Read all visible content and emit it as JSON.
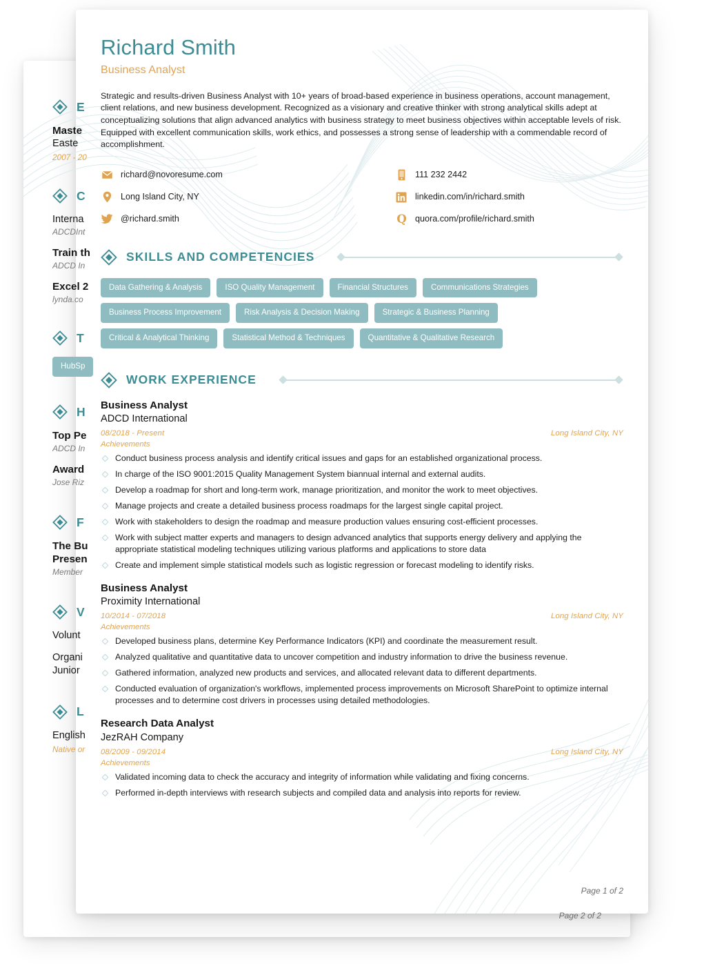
{
  "document": {
    "type": "resume",
    "theme": {
      "teal": "#3E8C93",
      "orange": "#E0A451",
      "chip": "#8FBCC0",
      "rule": "#CEDFE2",
      "text": "#1b1b1b"
    }
  },
  "page_front": {
    "footer": "Page 1 of 2",
    "header": {
      "name": "Richard Smith",
      "job_title": "Business Analyst",
      "summary": "Strategic and results-driven Business Analyst with 10+ years of broad-based experience in business operations, account management, client relations, and new business development. Recognized as a visionary and creative thinker with strong analytical skills adept at conceptualizing solutions that align advanced analytics with business strategy to meet business objectives within acceptable levels of risk. Equipped with excellent communication skills, work ethics, and possesses a strong sense of leadership with a commendable record of accomplishment."
    },
    "contacts": {
      "left": [
        {
          "icon": "email-icon",
          "value": "richard@novoresume.com"
        },
        {
          "icon": "location-icon",
          "value": "Long Island City, NY"
        },
        {
          "icon": "twitter-icon",
          "value": "@richard.smith"
        }
      ],
      "right": [
        {
          "icon": "phone-icon",
          "value": "111 232 2442"
        },
        {
          "icon": "linkedin-icon",
          "value": "linkedin.com/in/richard.smith"
        },
        {
          "icon": "quora-icon",
          "value": "quora.com/profile/richard.smith"
        }
      ]
    },
    "skills_section": {
      "title": "SKILLS AND COMPETENCIES",
      "chips": [
        "Data Gathering & Analysis",
        "ISO Quality Management",
        "Financial Structures",
        "Communications Strategies",
        "Business Process Improvement",
        "Risk Analysis & Decision Making",
        "Strategic & Business Planning",
        "Critical & Analytical Thinking",
        "Statistical Method & Techniques",
        "Quantitative & Qualitative Research"
      ]
    },
    "experience_section": {
      "title": "WORK EXPERIENCE",
      "achievements_label": "Achievements",
      "jobs": [
        {
          "title": "Business Analyst",
          "company": "ADCD International",
          "date": "08/2018 - Present",
          "location": "Long Island City, NY",
          "bullets": [
            "Conduct business process analysis and identify critical issues and gaps for an established organizational process.",
            "In charge of the ISO 9001:2015 Quality Management System biannual internal and external audits.",
            "Develop a roadmap for short and long-term work, manage prioritization, and monitor the work to meet objectives.",
            "Manage projects and create a detailed business process roadmaps for the largest single capital project.",
            "Work with stakeholders to design the roadmap and measure production values ensuring cost-efficient processes.",
            "Work with subject matter experts and managers to design advanced analytics that supports energy delivery and applying the appropriate statistical modeling techniques utilizing various platforms and applications to store data",
            "Create and implement simple statistical models such as logistic regression or forecast modeling to identify risks."
          ]
        },
        {
          "title": "Business Analyst",
          "company": "Proximity International",
          "date": "10/2014 - 07/2018",
          "location": "Long Island City, NY",
          "bullets": [
            "Developed business plans, determine Key Performance Indicators (KPI) and coordinate the measurement result.",
            "Analyzed qualitative and quantitative data to uncover competition and industry information to drive the business revenue.",
            "Gathered information, analyzed new products and services, and allocated relevant data to different departments.",
            "Conducted evaluation of organization's workflows, implemented process improvements on Microsoft SharePoint to optimize internal processes and to determine cost drivers in processes using detailed methodologies."
          ]
        },
        {
          "title": "Research Data Analyst",
          "company": "JezRAH Company",
          "date": "08/2009 - 09/2014",
          "location": "Long Island City, NY",
          "bullets": [
            "Validated incoming data to check the accuracy and integrity of information while validating and fixing concerns.",
            "Performed in-depth interviews with research subjects and compiled data and analysis into reports for review."
          ]
        }
      ]
    }
  },
  "page_back": {
    "footer": "Page 2 of 2",
    "sections": [
      {
        "title": "E",
        "entries": [
          {
            "line1": "Maste",
            "line2": "Easte",
            "sub": "",
            "date": "2007 - 20"
          }
        ]
      },
      {
        "title": "C",
        "entries": [
          {
            "line1": "Interna",
            "line1_regular": true,
            "sub": "ADCDInt",
            "date": ""
          },
          {
            "line1": "Train th",
            "sub": "ADCD In",
            "date": ""
          },
          {
            "line1": "Excel 2",
            "sub": "lynda.co",
            "date": ""
          }
        ]
      },
      {
        "title": "T",
        "chip": "HubSp",
        "entries": []
      },
      {
        "title": "H",
        "entries": [
          {
            "line1": "Top Pe",
            "sub": "ADCD In",
            "date": ""
          },
          {
            "line1": "Award",
            "sub": "Jose Riz",
            "date": ""
          }
        ]
      },
      {
        "title": "F",
        "entries": [
          {
            "line1": "The Bu",
            "line2": "Presen",
            "sub": "Member",
            "date": ""
          }
        ]
      },
      {
        "title": "V",
        "entries": [
          {
            "line1": "Volunt",
            "line1_regular": true,
            "sub": "",
            "date": ""
          },
          {
            "line1": "Organi",
            "line1_regular": true,
            "line2": "Junior",
            "sub": "",
            "date": ""
          }
        ]
      },
      {
        "title": "L",
        "entries": [
          {
            "line1": "English",
            "line1_regular": true,
            "sub": "",
            "date": "Native or"
          }
        ]
      }
    ]
  }
}
